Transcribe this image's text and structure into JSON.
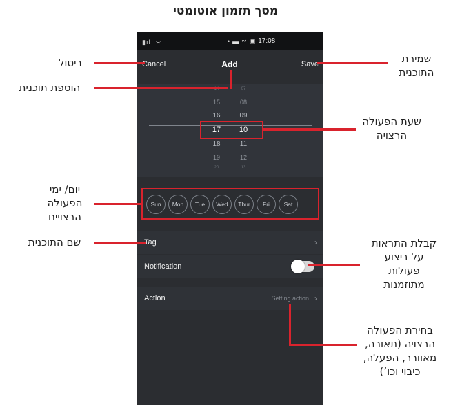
{
  "page_title": "מסך תזמון אוטומטי",
  "status_bar": {
    "left_icons": "▮ıl. ᯤ",
    "icons": [
      "•",
      "▬",
      "∾",
      "▣"
    ],
    "time": "17:08"
  },
  "header": {
    "cancel_label": "Cancel",
    "title": "Add",
    "save_label": "Save"
  },
  "time_picker": {
    "hours": [
      "14",
      "15",
      "16",
      "17",
      "18",
      "19",
      "20"
    ],
    "minutes": [
      "07",
      "08",
      "09",
      "10",
      "11",
      "12",
      "13"
    ],
    "selected_hour": "17",
    "selected_minute": "10"
  },
  "days": [
    "Sun",
    "Mon",
    "Tue",
    "Wed",
    "Thur",
    "Fri",
    "Sat"
  ],
  "rows": {
    "tag_label": "Tag",
    "notification_label": "Notification",
    "notification_on": false,
    "action_label": "Action",
    "action_value": "Setting action"
  },
  "annotations": {
    "cancel": "ביטול",
    "add": "הוספת תוכנית",
    "save_line1": "שמירת",
    "save_line2": "התוכנית",
    "time_line1": "שעת הפעולה",
    "time_line2": "הרצויה",
    "days_line1": "יום/ ימי",
    "days_line2": "הפעולה",
    "days_line3": "הרצויים",
    "tag": "שם התוכנית",
    "notif_line1": "קבלת התראות",
    "notif_line2": "על ביצוע",
    "notif_line3": "פעולות",
    "notif_line4": "מתוזמנות",
    "action_line1": "בחירת הפעולה",
    "action_line2": "הרצויה (תאורה,",
    "action_line3": "מאוורר, הפעלה,",
    "action_line4": "כיבוי וכו’)"
  },
  "colors": {
    "accent_red": "#d9232d",
    "phone_bg": "#2b2d31"
  }
}
